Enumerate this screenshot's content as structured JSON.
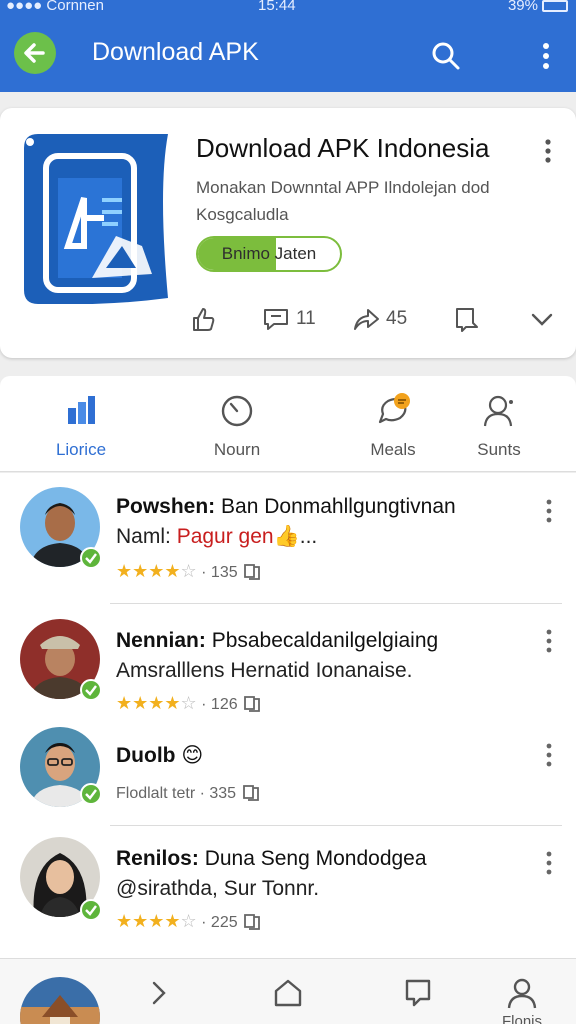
{
  "status_bar": {
    "carrier": "●●●● Cornnen",
    "time": "15:44",
    "battery": "39%"
  },
  "app_bar": {
    "title": "Download APK"
  },
  "app_card": {
    "title": "Download APK Indonesia",
    "subtitle": "Monakan Downntal APP Ilndolejan dod Kosgcaludla",
    "install_label": "Bnimo Jaten",
    "install_progress": 0.55,
    "actions": [
      {
        "icon": "thumbs-up-icon",
        "count": ""
      },
      {
        "icon": "comment-icon",
        "count": "11"
      },
      {
        "icon": "share-icon",
        "count": "45"
      },
      {
        "icon": "bookmark-icon",
        "count": ""
      }
    ]
  },
  "categories": [
    {
      "label": "Liorice",
      "icon": "chart-icon",
      "active": true
    },
    {
      "label": "Nourn",
      "icon": "clock-icon",
      "active": false
    },
    {
      "label": "Meals",
      "icon": "chat-bubble-icon",
      "active": false
    },
    {
      "label": "Sunts",
      "icon": "person-icon",
      "active": false
    }
  ],
  "reviews": [
    {
      "name": "Powshen:",
      "headline": "Ban Donmahllgungtivnan",
      "line2_prefix": "Naml: ",
      "line2_highlight": "Pagur gen",
      "line2_suffix": "👍...",
      "rating": 4,
      "count": "135"
    },
    {
      "name": "Nennian:",
      "headline": "Pbsabecaldanilgelgiaing",
      "line2_prefix": "Amsralllens Hernatid Ionanaise.",
      "line2_highlight": "",
      "line2_suffix": "",
      "rating": 4,
      "count": "126"
    },
    {
      "name": "Duolb",
      "headline": "😊",
      "meta_text": "Flodlalt tetr · 335",
      "rating": 0,
      "count": ""
    },
    {
      "name": "Renilos:",
      "headline": "Duna Seng Mondodgea",
      "line2_prefix": "@sirathda, Sur Tonnr.",
      "line2_highlight": "",
      "line2_suffix": "",
      "rating": 4,
      "count": "225"
    }
  ],
  "bottom_nav": {
    "label": "Flonis"
  },
  "colors": {
    "primary": "#2f6fd3",
    "accent_green": "#7cbd3d",
    "star": "#f2b01e"
  }
}
